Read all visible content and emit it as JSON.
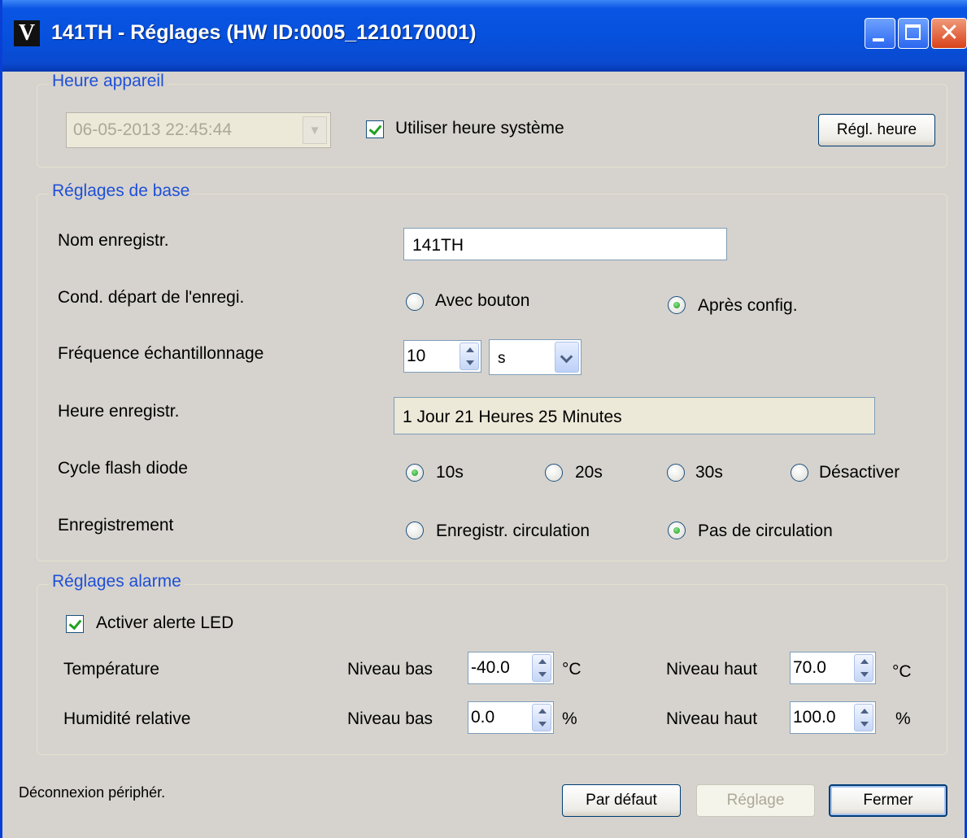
{
  "window": {
    "icon_letter": "V",
    "title": "141TH - Réglages (HW ID:0005_1210170001)",
    "controls": [
      "minimize",
      "maximize",
      "close"
    ]
  },
  "device_time": {
    "group_title": "Heure appareil",
    "datetime_value": "06-05-2013 22:45:44",
    "use_system_time_label": "Utiliser heure système",
    "use_system_time_checked": true,
    "set_time_button": "Régl. heure"
  },
  "basic": {
    "group_title": "Réglages de base",
    "record_name_label": "Nom enregistr.",
    "record_name_value": "141TH",
    "start_condition_label": "Cond. départ de l'enregi.",
    "start_options": [
      "Avec bouton",
      "Après config."
    ],
    "start_selected": "Après config.",
    "sampling_label": "Fréquence échantillonnage",
    "sampling_value": "10",
    "sampling_unit": "s",
    "record_time_label": "Heure enregistr.",
    "record_time_value": "1 Jour 21 Heures 25 Minutes",
    "led_cycle_label": "Cycle flash diode",
    "led_options": [
      "10s",
      "20s",
      "30s",
      "Désactiver"
    ],
    "led_selected": "10s",
    "recording_label": "Enregistrement",
    "recording_options": [
      "Enregistr. circulation",
      "Pas de circulation"
    ],
    "recording_selected": "Pas de circulation"
  },
  "alarm": {
    "group_title": "Réglages alarme",
    "led_alert_label": "Activer alerte LED",
    "led_alert_checked": true,
    "temperature": {
      "label": "Température",
      "low_label": "Niveau bas",
      "low_value": "-40.0",
      "low_unit": "°C",
      "high_label": "Niveau haut",
      "high_value": "70.0",
      "high_unit": "°C"
    },
    "humidity": {
      "label": "Humidité relative",
      "low_label": "Niveau bas",
      "low_value": "0.0",
      "low_unit": "%",
      "high_label": "Niveau haut",
      "high_value": "100.0",
      "high_unit": "%"
    }
  },
  "footer": {
    "status": "Déconnexion périphér.",
    "default_button": "Par défaut",
    "apply_button": "Réglage",
    "close_button": "Fermer"
  }
}
